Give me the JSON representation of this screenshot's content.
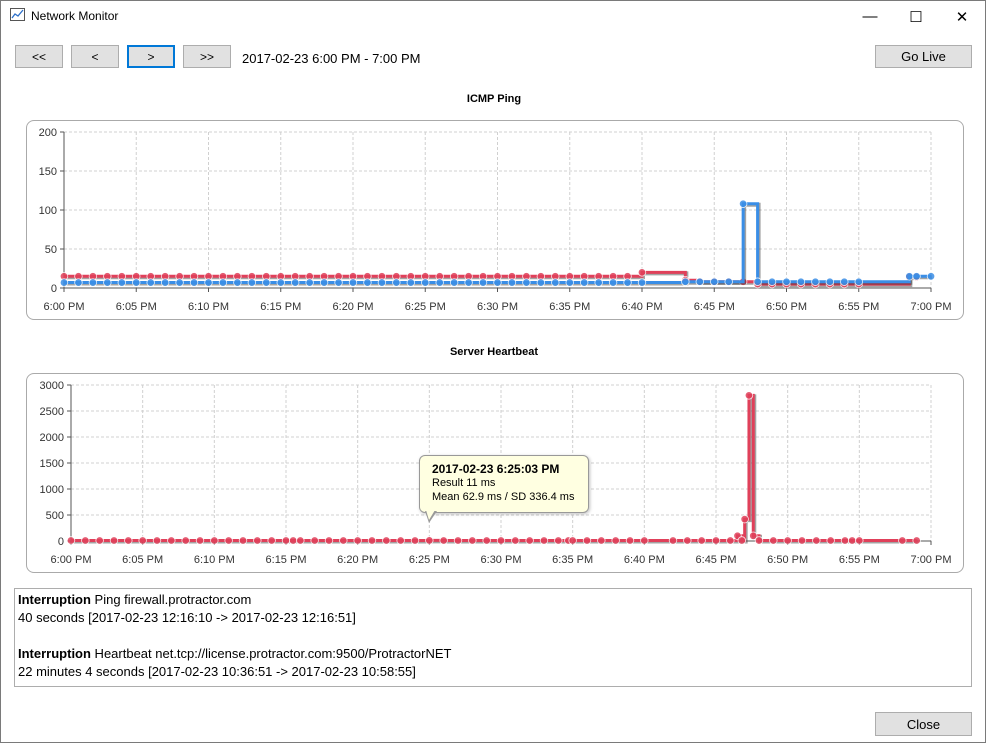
{
  "window": {
    "title": "Network Monitor",
    "icon": "chart-line-icon",
    "controls": {
      "minimize": "—",
      "maximize": "☐",
      "close": "✕"
    }
  },
  "toolbar": {
    "first_label": "<<",
    "prev_label": "<",
    "next_label": ">",
    "last_label": ">>",
    "range_label": "2017-02-23 6:00 PM - 7:00 PM",
    "go_live_label": "Go Live"
  },
  "colors": {
    "series_red": "#e0405a",
    "series_blue": "#3a8ee6",
    "grid": "#d0d0d0",
    "button_bg": "#e1e1e1",
    "focus": "#0078d7",
    "tooltip_bg": "#ffffe1"
  },
  "chart_data": [
    {
      "type": "line",
      "title": "ICMP Ping",
      "xlabel": "",
      "ylabel": "",
      "xlim_minutes": [
        0,
        60
      ],
      "ylim": [
        0,
        200
      ],
      "x_tick_labels": [
        "6:00 PM",
        "6:05 PM",
        "6:10 PM",
        "6:15 PM",
        "6:20 PM",
        "6:25 PM",
        "6:30 PM",
        "6:35 PM",
        "6:40 PM",
        "6:45 PM",
        "6:50 PM",
        "6:55 PM",
        "7:00 PM"
      ],
      "y_tick_labels": [
        "0",
        "50",
        "100",
        "150",
        "200"
      ],
      "grid": true,
      "series": [
        {
          "color": "#e0405a",
          "step": true,
          "points": [
            [
              0,
              15
            ],
            [
              1,
              15
            ],
            [
              2,
              15
            ],
            [
              3,
              15
            ],
            [
              4,
              15
            ],
            [
              5,
              15
            ],
            [
              6,
              15
            ],
            [
              7,
              15
            ],
            [
              8,
              15
            ],
            [
              9,
              15
            ],
            [
              10,
              15
            ],
            [
              11,
              15
            ],
            [
              12,
              15
            ],
            [
              13,
              15
            ],
            [
              14,
              15
            ],
            [
              15,
              15
            ],
            [
              16,
              15
            ],
            [
              17,
              15
            ],
            [
              18,
              15
            ],
            [
              19,
              15
            ],
            [
              20,
              15
            ],
            [
              21,
              15
            ],
            [
              22,
              15
            ],
            [
              23,
              15
            ],
            [
              24,
              15
            ],
            [
              25,
              15
            ],
            [
              26,
              15
            ],
            [
              27,
              15
            ],
            [
              28,
              15
            ],
            [
              29,
              15
            ],
            [
              30,
              15
            ],
            [
              31,
              15
            ],
            [
              32,
              15
            ],
            [
              33,
              15
            ],
            [
              34,
              15
            ],
            [
              35,
              15
            ],
            [
              36,
              15
            ],
            [
              37,
              15
            ],
            [
              38,
              15
            ],
            [
              39,
              15
            ],
            [
              40,
              20
            ],
            [
              43,
              10
            ],
            [
              44,
              8
            ],
            [
              45,
              8
            ],
            [
              46,
              8
            ],
            [
              47,
              8
            ],
            [
              48,
              5
            ],
            [
              49,
              5
            ],
            [
              50,
              5
            ],
            [
              51,
              5
            ],
            [
              52,
              5
            ],
            [
              53,
              5
            ],
            [
              54,
              5
            ],
            [
              55,
              5
            ],
            [
              58.5,
              14
            ],
            [
              59,
              14
            ]
          ]
        },
        {
          "color": "#3a8ee6",
          "step": true,
          "points": [
            [
              0,
              7
            ],
            [
              1,
              7
            ],
            [
              2,
              7
            ],
            [
              3,
              7
            ],
            [
              4,
              7
            ],
            [
              5,
              7
            ],
            [
              6,
              7
            ],
            [
              7,
              7
            ],
            [
              8,
              7
            ],
            [
              9,
              7
            ],
            [
              10,
              7
            ],
            [
              11,
              7
            ],
            [
              12,
              7
            ],
            [
              13,
              7
            ],
            [
              14,
              7
            ],
            [
              15,
              7
            ],
            [
              16,
              7
            ],
            [
              17,
              7
            ],
            [
              18,
              7
            ],
            [
              19,
              7
            ],
            [
              20,
              7
            ],
            [
              21,
              7
            ],
            [
              22,
              7
            ],
            [
              23,
              7
            ],
            [
              24,
              7
            ],
            [
              25,
              7
            ],
            [
              26,
              7
            ],
            [
              27,
              7
            ],
            [
              28,
              7
            ],
            [
              29,
              7
            ],
            [
              30,
              7
            ],
            [
              31,
              7
            ],
            [
              32,
              7
            ],
            [
              33,
              7
            ],
            [
              34,
              7
            ],
            [
              35,
              7
            ],
            [
              36,
              7
            ],
            [
              37,
              7
            ],
            [
              38,
              7
            ],
            [
              39,
              7
            ],
            [
              40,
              7
            ],
            [
              43,
              8
            ],
            [
              44,
              8
            ],
            [
              45,
              8
            ],
            [
              46,
              8
            ],
            [
              47,
              108
            ],
            [
              48,
              8
            ],
            [
              49,
              8
            ],
            [
              50,
              8
            ],
            [
              51,
              8
            ],
            [
              52,
              8
            ],
            [
              53,
              8
            ],
            [
              54,
              8
            ],
            [
              55,
              8
            ],
            [
              58.5,
              15
            ],
            [
              59,
              15
            ],
            [
              60,
              15
            ]
          ]
        }
      ]
    },
    {
      "type": "line",
      "title": "Server Heartbeat",
      "xlabel": "",
      "ylabel": "",
      "xlim_minutes": [
        0,
        60
      ],
      "ylim": [
        0,
        3000
      ],
      "x_tick_labels": [
        "6:00 PM",
        "6:05 PM",
        "6:10 PM",
        "6:15 PM",
        "6:20 PM",
        "6:25 PM",
        "6:30 PM",
        "6:35 PM",
        "6:40 PM",
        "6:45 PM",
        "6:50 PM",
        "6:55 PM",
        "7:00 PM"
      ],
      "y_tick_labels": [
        "0",
        "500",
        "1000",
        "1500",
        "2000",
        "2500",
        "3000"
      ],
      "grid": true,
      "series": [
        {
          "color": "#e0405a",
          "step": true,
          "points": [
            [
              0,
              10
            ],
            [
              1,
              10
            ],
            [
              2,
              10
            ],
            [
              3,
              10
            ],
            [
              4,
              10
            ],
            [
              5,
              10
            ],
            [
              6,
              10
            ],
            [
              7,
              10
            ],
            [
              8,
              10
            ],
            [
              9,
              10
            ],
            [
              10,
              10
            ],
            [
              11,
              10
            ],
            [
              12,
              10
            ],
            [
              13,
              10
            ],
            [
              14,
              10
            ],
            [
              15,
              10
            ],
            [
              15.5,
              10
            ],
            [
              16,
              10
            ],
            [
              17,
              10
            ],
            [
              18,
              10
            ],
            [
              19,
              10
            ],
            [
              20,
              10
            ],
            [
              21,
              10
            ],
            [
              22,
              10
            ],
            [
              23,
              10
            ],
            [
              24,
              10
            ],
            [
              25,
              11
            ],
            [
              26,
              10
            ],
            [
              27,
              10
            ],
            [
              28,
              10
            ],
            [
              29,
              10
            ],
            [
              30,
              10
            ],
            [
              31,
              10
            ],
            [
              32,
              10
            ],
            [
              33,
              10
            ],
            [
              34,
              10
            ],
            [
              34.7,
              10
            ],
            [
              35,
              10
            ],
            [
              36,
              10
            ],
            [
              37,
              10
            ],
            [
              38,
              10
            ],
            [
              39,
              10
            ],
            [
              40,
              10
            ],
            [
              42,
              10
            ],
            [
              43,
              10
            ],
            [
              44,
              10
            ],
            [
              45,
              10
            ],
            [
              46,
              10
            ],
            [
              46.5,
              100
            ],
            [
              46.8,
              10
            ],
            [
              47,
              420
            ],
            [
              47.3,
              2800
            ],
            [
              47.6,
              100
            ],
            [
              48,
              10
            ],
            [
              49,
              10
            ],
            [
              50,
              10
            ],
            [
              51,
              10
            ],
            [
              52,
              10
            ],
            [
              53,
              10
            ],
            [
              54,
              10
            ],
            [
              54.5,
              10
            ],
            [
              55,
              10
            ],
            [
              58,
              10
            ],
            [
              59,
              10
            ]
          ]
        }
      ]
    }
  ],
  "tooltip": {
    "title": "2017-02-23 6:25:03 PM",
    "line1": "Result 11 ms",
    "line2": "Mean 62.9 ms / SD 336.4 ms"
  },
  "log": {
    "entries": [
      {
        "kind": "Interruption",
        "target": " Ping firewall.protractor.com",
        "detail": "40 seconds [2017-02-23 12:16:10 -> 2017-02-23 12:16:51]"
      },
      {
        "kind": "Interruption",
        "target": " Heartbeat net.tcp://license.protractor.com:9500/ProtractorNET",
        "detail": "22 minutes 4 seconds [2017-02-23 10:36:51 -> 2017-02-23 10:58:55]"
      }
    ]
  },
  "footer": {
    "close_label": "Close"
  }
}
